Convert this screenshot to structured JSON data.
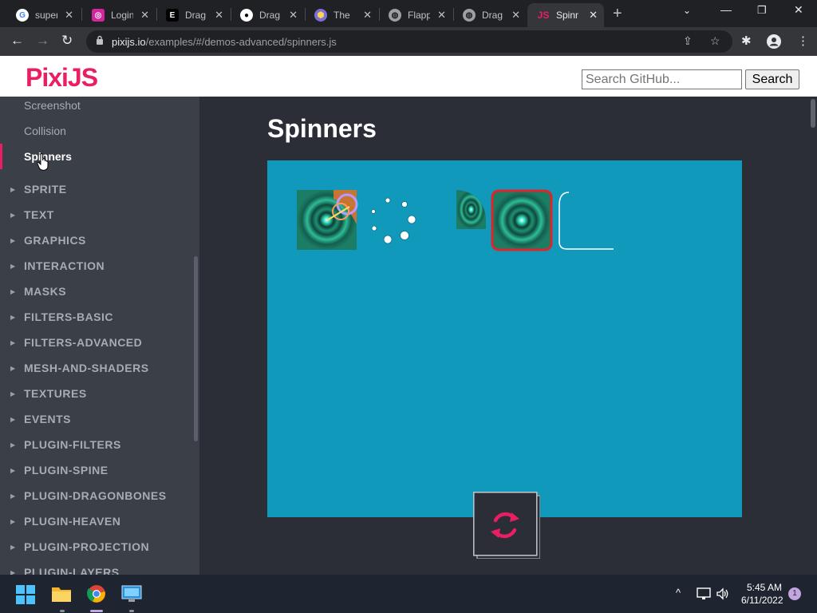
{
  "browser": {
    "tabs": [
      {
        "title": "super",
        "icon": "google-icon"
      },
      {
        "title": "Login",
        "icon": "instagram-icon"
      },
      {
        "title": "Drag",
        "icon": "e-icon"
      },
      {
        "title": "Drag",
        "icon": "github-icon"
      },
      {
        "title": "The",
        "icon": "hexagon-icon"
      },
      {
        "title": "Flapp",
        "icon": "globe-icon"
      },
      {
        "title": "Drag",
        "icon": "globe-icon"
      },
      {
        "title": "Spinn",
        "icon": "pixijs-icon",
        "active": true
      }
    ],
    "url_host": "pixijs.io",
    "url_path": "/examples/#/demos-advanced/spinners.js"
  },
  "header": {
    "logo": "PixiJS",
    "search_placeholder": "Search GitHub...",
    "search_button": "Search"
  },
  "sidebar": {
    "sub_items": [
      "Screenshot",
      "Collision",
      "Spinners"
    ],
    "active_item": "Spinners",
    "categories": [
      "SPRITE",
      "TEXT",
      "GRAPHICS",
      "INTERACTION",
      "MASKS",
      "FILTERS-BASIC",
      "FILTERS-ADVANCED",
      "MESH-AND-SHADERS",
      "TEXTURES",
      "EVENTS",
      "PLUGIN-FILTERS",
      "PLUGIN-SPINE",
      "PLUGIN-DRAGONBONES",
      "PLUGIN-HEAVEN",
      "PLUGIN-PROJECTION",
      "PLUGIN-LAYERS"
    ]
  },
  "main": {
    "title": "Spinners",
    "stage_color": "#1099bb",
    "accent_color": "#e91e63"
  },
  "taskbar": {
    "time": "5:45 AM",
    "date": "6/11/2022",
    "notifications": "1"
  }
}
